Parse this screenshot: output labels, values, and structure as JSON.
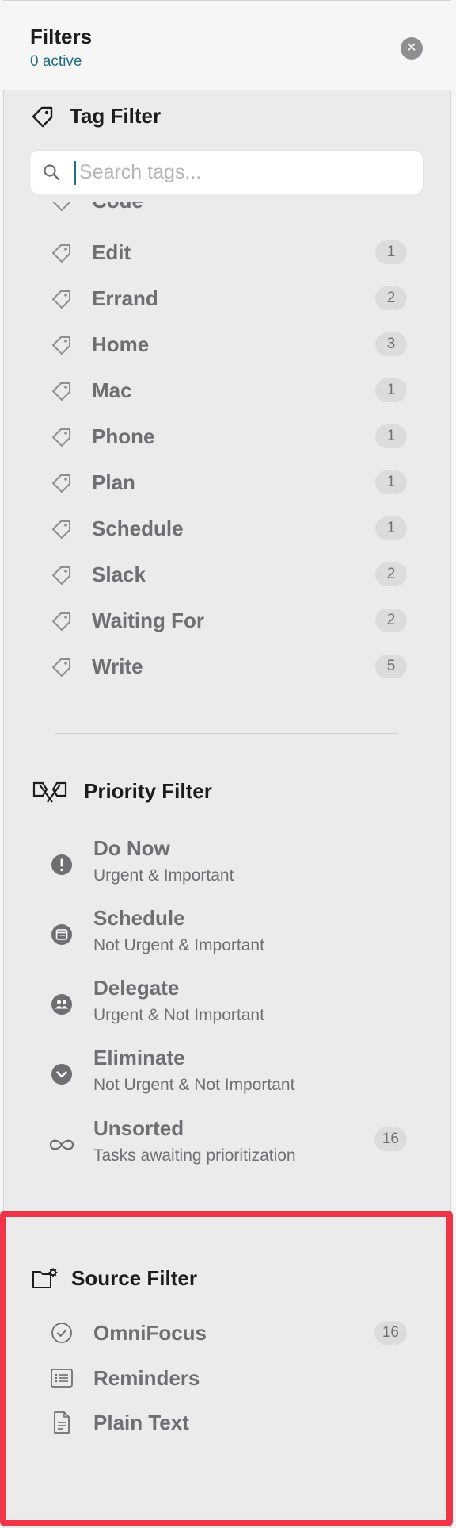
{
  "header": {
    "title": "Filters",
    "active": "0 active",
    "close_icon": "close-icon"
  },
  "tag_filter": {
    "title": "Tag Filter",
    "search_placeholder": "Search tags...",
    "partial_item": {
      "name": "Code"
    },
    "items": [
      {
        "name": "Edit",
        "count": "1"
      },
      {
        "name": "Errand",
        "count": "2"
      },
      {
        "name": "Home",
        "count": "3"
      },
      {
        "name": "Mac",
        "count": "1"
      },
      {
        "name": "Phone",
        "count": "1"
      },
      {
        "name": "Plan",
        "count": "1"
      },
      {
        "name": "Schedule",
        "count": "1"
      },
      {
        "name": "Slack",
        "count": "2"
      },
      {
        "name": "Waiting For",
        "count": "2"
      },
      {
        "name": "Write",
        "count": "5"
      }
    ]
  },
  "priority_filter": {
    "title": "Priority Filter",
    "items": [
      {
        "name": "Do Now",
        "desc": "Urgent & Important",
        "icon": "exclamation-icon"
      },
      {
        "name": "Schedule",
        "desc": "Not Urgent & Important",
        "icon": "calendar-icon"
      },
      {
        "name": "Delegate",
        "desc": "Urgent & Not Important",
        "icon": "people-icon"
      },
      {
        "name": "Eliminate",
        "desc": "Not Urgent & Not Important",
        "icon": "chevron-down-icon"
      },
      {
        "name": "Unsorted",
        "desc": "Tasks awaiting prioritization",
        "icon": "infinity-icon",
        "count": "16"
      }
    ]
  },
  "source_filter": {
    "title": "Source Filter",
    "items": [
      {
        "name": "OmniFocus",
        "count": "16",
        "icon": "checkmark-circle-icon"
      },
      {
        "name": "Reminders",
        "icon": "list-icon"
      },
      {
        "name": "Plain Text",
        "icon": "document-icon"
      }
    ]
  },
  "colors": {
    "accent": "#1f6e7d",
    "highlight": "#f0344a",
    "panel": "#ebebeb"
  }
}
